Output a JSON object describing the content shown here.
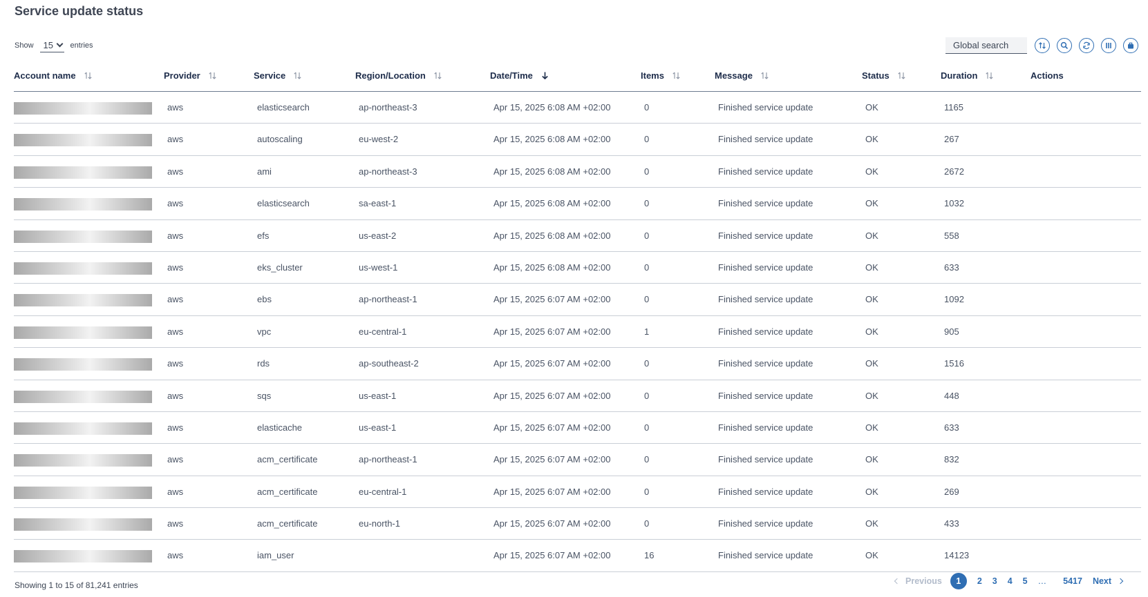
{
  "title": "Service update status",
  "length_menu": {
    "show_label": "Show",
    "value": "15",
    "entries_label": "entries"
  },
  "search": {
    "placeholder": "Global search"
  },
  "toolbar_icons": [
    "sort-reset-icon",
    "search-icon",
    "refresh-icon",
    "columns-icon",
    "export-icon"
  ],
  "columns": [
    {
      "label": "Account name",
      "sort": "none"
    },
    {
      "label": "Provider",
      "sort": "none"
    },
    {
      "label": "Service",
      "sort": "none"
    },
    {
      "label": "Region/Location",
      "sort": "none"
    },
    {
      "label": "Date/Time",
      "sort": "desc"
    },
    {
      "label": "Items",
      "sort": "none"
    },
    {
      "label": "Message",
      "sort": "none"
    },
    {
      "label": "Status",
      "sort": "none"
    },
    {
      "label": "Duration",
      "sort": "none"
    },
    {
      "label": "Actions",
      "sort": ""
    }
  ],
  "rows": [
    {
      "provider": "aws",
      "service": "elasticsearch",
      "region": "ap-northeast-3",
      "datetime": "Apr 15, 2025 6:08 AM +02:00",
      "items": "0",
      "message": "Finished service update",
      "status": "OK",
      "duration": "1165"
    },
    {
      "provider": "aws",
      "service": "autoscaling",
      "region": "eu-west-2",
      "datetime": "Apr 15, 2025 6:08 AM +02:00",
      "items": "0",
      "message": "Finished service update",
      "status": "OK",
      "duration": "267"
    },
    {
      "provider": "aws",
      "service": "ami",
      "region": "ap-northeast-3",
      "datetime": "Apr 15, 2025 6:08 AM +02:00",
      "items": "0",
      "message": "Finished service update",
      "status": "OK",
      "duration": "2672"
    },
    {
      "provider": "aws",
      "service": "elasticsearch",
      "region": "sa-east-1",
      "datetime": "Apr 15, 2025 6:08 AM +02:00",
      "items": "0",
      "message": "Finished service update",
      "status": "OK",
      "duration": "1032"
    },
    {
      "provider": "aws",
      "service": "efs",
      "region": "us-east-2",
      "datetime": "Apr 15, 2025 6:08 AM +02:00",
      "items": "0",
      "message": "Finished service update",
      "status": "OK",
      "duration": "558"
    },
    {
      "provider": "aws",
      "service": "eks_cluster",
      "region": "us-west-1",
      "datetime": "Apr 15, 2025 6:08 AM +02:00",
      "items": "0",
      "message": "Finished service update",
      "status": "OK",
      "duration": "633"
    },
    {
      "provider": "aws",
      "service": "ebs",
      "region": "ap-northeast-1",
      "datetime": "Apr 15, 2025 6:07 AM +02:00",
      "items": "0",
      "message": "Finished service update",
      "status": "OK",
      "duration": "1092"
    },
    {
      "provider": "aws",
      "service": "vpc",
      "region": "eu-central-1",
      "datetime": "Apr 15, 2025 6:07 AM +02:00",
      "items": "1",
      "message": "Finished service update",
      "status": "OK",
      "duration": "905"
    },
    {
      "provider": "aws",
      "service": "rds",
      "region": "ap-southeast-2",
      "datetime": "Apr 15, 2025 6:07 AM +02:00",
      "items": "0",
      "message": "Finished service update",
      "status": "OK",
      "duration": "1516"
    },
    {
      "provider": "aws",
      "service": "sqs",
      "region": "us-east-1",
      "datetime": "Apr 15, 2025 6:07 AM +02:00",
      "items": "0",
      "message": "Finished service update",
      "status": "OK",
      "duration": "448"
    },
    {
      "provider": "aws",
      "service": "elasticache",
      "region": "us-east-1",
      "datetime": "Apr 15, 2025 6:07 AM +02:00",
      "items": "0",
      "message": "Finished service update",
      "status": "OK",
      "duration": "633"
    },
    {
      "provider": "aws",
      "service": "acm_certificate",
      "region": "ap-northeast-1",
      "datetime": "Apr 15, 2025 6:07 AM +02:00",
      "items": "0",
      "message": "Finished service update",
      "status": "OK",
      "duration": "832"
    },
    {
      "provider": "aws",
      "service": "acm_certificate",
      "region": "eu-central-1",
      "datetime": "Apr 15, 2025 6:07 AM +02:00",
      "items": "0",
      "message": "Finished service update",
      "status": "OK",
      "duration": "269"
    },
    {
      "provider": "aws",
      "service": "acm_certificate",
      "region": "eu-north-1",
      "datetime": "Apr 15, 2025 6:07 AM +02:00",
      "items": "0",
      "message": "Finished service update",
      "status": "OK",
      "duration": "433"
    },
    {
      "provider": "aws",
      "service": "iam_user",
      "region": "",
      "datetime": "Apr 15, 2025 6:07 AM +02:00",
      "items": "16",
      "message": "Finished service update",
      "status": "OK",
      "duration": "14123"
    }
  ],
  "footer": {
    "info": "Showing 1 to 15 of 81,241 entries"
  },
  "pagination": {
    "previous": "Previous",
    "pages": [
      "1",
      "2",
      "3",
      "4",
      "5"
    ],
    "current": "1",
    "ellipsis": "…",
    "last": "5417",
    "next": "Next"
  },
  "colors": {
    "accent": "#2f6eb3",
    "header_text": "#1d2c4a",
    "body_text": "#495364",
    "disabled": "#b3bccb"
  }
}
